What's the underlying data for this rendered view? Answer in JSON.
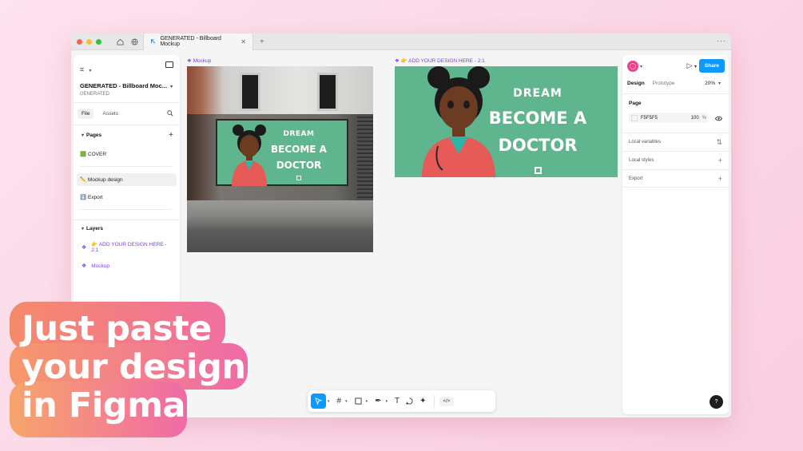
{
  "browser": {
    "tab_title": "GENERATED - Billboard Mockup",
    "tab_close": "✕",
    "tab_add": "+",
    "more": "···",
    "home_icon": "home-icon",
    "globe_icon": "globe-icon"
  },
  "left_panel": {
    "logo": "⌗",
    "file_title": "GENERATED - Billboard Moc...",
    "file_subtitle": "GENERATED",
    "tabs": [
      "File",
      "Assets"
    ],
    "pages_label": "Pages",
    "pages": [
      {
        "label": "🟩 COVER"
      },
      {
        "label": "✏️ Mockup design"
      },
      {
        "label": "⬇️ Export"
      }
    ],
    "layers_label": "Layers",
    "layers": [
      {
        "label": "👉 ADD YOUR DESIGN HERE - 2:1"
      },
      {
        "label": "Mockup"
      }
    ]
  },
  "canvas": {
    "mockup_label": "Mockup",
    "design_label": "👉 ADD YOUR DESIGN HERE - 2:1",
    "billboard": {
      "line1": "DREAM",
      "line2": "BECOME A",
      "line3": "DOCTOR",
      "color": "#5FB58D"
    }
  },
  "right_panel": {
    "share_label": "Share",
    "tabs": [
      "Design",
      "Prototype"
    ],
    "zoom": "20%",
    "page_label": "Page",
    "fill_hex": "F5F5F5",
    "fill_opacity": "100",
    "fill_pct": "%",
    "rows": [
      "Local variables",
      "Local styles",
      "Export"
    ],
    "help": "?"
  },
  "toolbar": {
    "code_label": "</>"
  },
  "promo": {
    "line1": "Just paste",
    "line2": "your design",
    "line3": "in Figma"
  },
  "colors": {
    "accent": "#0D99FF",
    "layer_purple": "#7B3FE4",
    "avatar": "#EE3F8A"
  }
}
